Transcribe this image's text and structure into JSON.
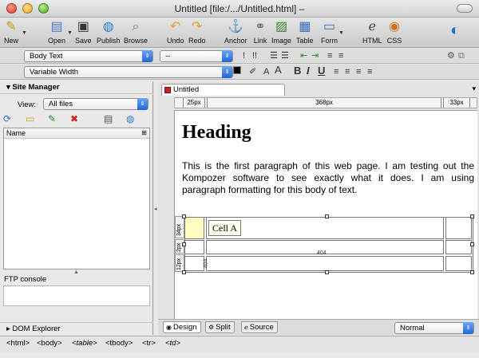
{
  "window": {
    "title": "Untitled [file:/.../Untitled.html] –"
  },
  "toolbar": {
    "new": "New",
    "open": "Open",
    "save": "Save",
    "publish": "Publish",
    "browse": "Browse",
    "undo": "Undo",
    "redo": "Redo",
    "anchor": "Anchor",
    "link": "Link",
    "image": "Image",
    "table": "Table",
    "form": "Form",
    "html": "HTML",
    "css": "CSS"
  },
  "format_bar": {
    "paragraph_style": "Body Text",
    "font_style": "--",
    "width_mode": "Variable Width"
  },
  "sidebar": {
    "site_manager": "Site Manager",
    "view_label": "View:",
    "view_value": "All files",
    "name_column": "Name",
    "ftp_console": "FTP console",
    "dom_explorer": "DOM Explorer"
  },
  "editor": {
    "tab_title": "Untitled",
    "ruler": [
      "25px",
      "368px",
      "33px"
    ],
    "heading": "Heading",
    "paragraph": "This is the first paragraph of this web page. I am testing out the Kompozer software to see exactly what it does. I am using paragraph formatting for this body of text.",
    "cell_a": "Cell A",
    "row_rulers": [
      "34px",
      "2px",
      "12px"
    ],
    "col_marker": "404",
    "row_marker": "404"
  },
  "modes": {
    "design": "Design",
    "split": "Split",
    "source": "Source",
    "view_mode": "Normal"
  },
  "status": {
    "breadcrumbs": [
      "<html>",
      "<body>",
      "<table>",
      "<tbody>",
      "<tr>",
      "<td>"
    ]
  }
}
